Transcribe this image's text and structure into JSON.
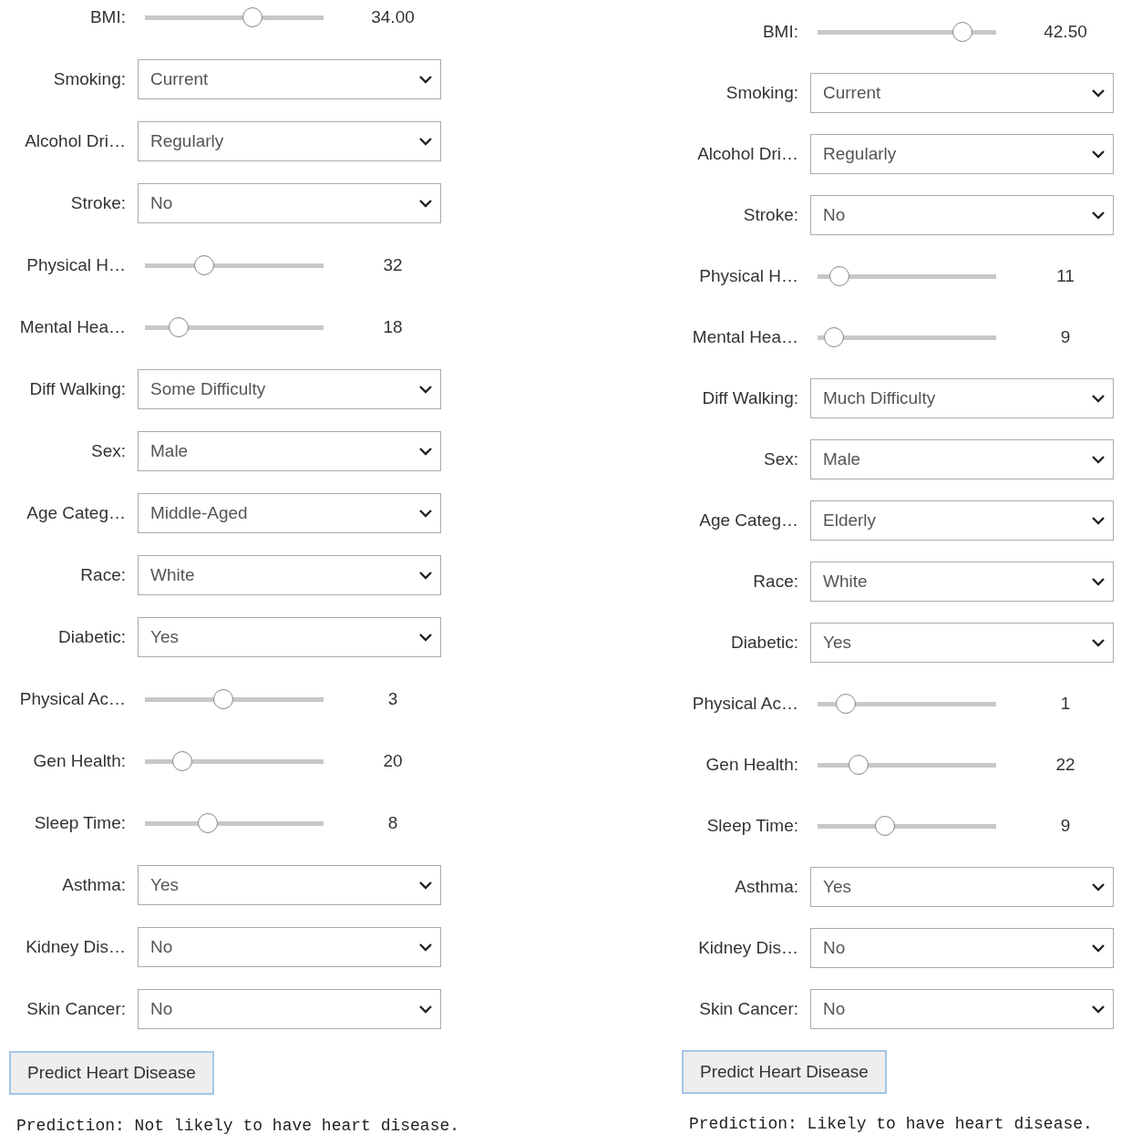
{
  "panels": [
    {
      "rows": [
        {
          "kind": "slider",
          "label": "BMI:",
          "level": 0.6,
          "reading": "34.00"
        },
        {
          "kind": "dropdown",
          "label": "Smoking:",
          "value": "Current"
        },
        {
          "kind": "dropdown",
          "label": "Alcohol Dri…",
          "value": "Regularly"
        },
        {
          "kind": "dropdown",
          "label": "Stroke:",
          "value": "No"
        },
        {
          "kind": "slider",
          "label": "Physical H…",
          "level": 0.33,
          "reading": "32"
        },
        {
          "kind": "slider",
          "label": "Mental Hea…",
          "level": 0.19,
          "reading": "18"
        },
        {
          "kind": "dropdown",
          "label": "Diff Walking:",
          "value": "Some Difficulty"
        },
        {
          "kind": "dropdown",
          "label": "Sex:",
          "value": "Male"
        },
        {
          "kind": "dropdown",
          "label": "Age Categ…",
          "value": "Middle-Aged"
        },
        {
          "kind": "dropdown",
          "label": "Race:",
          "value": "White"
        },
        {
          "kind": "dropdown",
          "label": "Diabetic:",
          "value": "Yes"
        },
        {
          "kind": "slider",
          "label": "Physical Ac…",
          "level": 0.44,
          "reading": "3"
        },
        {
          "kind": "slider",
          "label": "Gen Health:",
          "level": 0.21,
          "reading": "20"
        },
        {
          "kind": "slider",
          "label": "Sleep Time:",
          "level": 0.35,
          "reading": "8"
        },
        {
          "kind": "dropdown",
          "label": "Asthma:",
          "value": "Yes"
        },
        {
          "kind": "dropdown",
          "label": "Kidney Dis…",
          "value": "No"
        },
        {
          "kind": "dropdown",
          "label": "Skin Cancer:",
          "value": "No"
        }
      ],
      "button": "Predict Heart Disease",
      "prediction": "Prediction: Not likely to have heart disease."
    },
    {
      "rows": [
        {
          "kind": "slider",
          "label": "BMI:",
          "level": 0.81,
          "reading": "42.50"
        },
        {
          "kind": "dropdown",
          "label": "Smoking:",
          "value": "Current"
        },
        {
          "kind": "dropdown",
          "label": "Alcohol Dri…",
          "value": "Regularly"
        },
        {
          "kind": "dropdown",
          "label": "Stroke:",
          "value": "No"
        },
        {
          "kind": "slider",
          "label": "Physical H…",
          "level": 0.12,
          "reading": "11"
        },
        {
          "kind": "slider",
          "label": "Mental Hea…",
          "level": 0.09,
          "reading": "9"
        },
        {
          "kind": "dropdown",
          "label": "Diff Walking:",
          "value": "Much Difficulty"
        },
        {
          "kind": "dropdown",
          "label": "Sex:",
          "value": "Male"
        },
        {
          "kind": "dropdown",
          "label": "Age Categ…",
          "value": "Elderly"
        },
        {
          "kind": "dropdown",
          "label": "Race:",
          "value": "White"
        },
        {
          "kind": "dropdown",
          "label": "Diabetic:",
          "value": "Yes"
        },
        {
          "kind": "slider",
          "label": "Physical Ac…",
          "level": 0.16,
          "reading": "1"
        },
        {
          "kind": "slider",
          "label": "Gen Health:",
          "level": 0.23,
          "reading": "22"
        },
        {
          "kind": "slider",
          "label": "Sleep Time:",
          "level": 0.38,
          "reading": "9"
        },
        {
          "kind": "dropdown",
          "label": "Asthma:",
          "value": "Yes"
        },
        {
          "kind": "dropdown",
          "label": "Kidney Dis…",
          "value": "No"
        },
        {
          "kind": "dropdown",
          "label": "Skin Cancer:",
          "value": "No"
        }
      ],
      "button": "Predict Heart Disease",
      "prediction": "Prediction: Likely to have heart disease."
    }
  ]
}
